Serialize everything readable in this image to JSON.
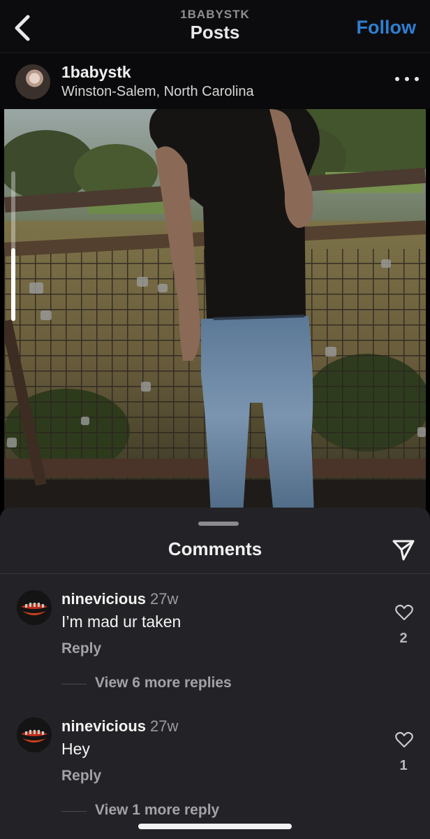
{
  "nav": {
    "subtitle": "1BABYSTK",
    "title": "Posts",
    "follow_label": "Follow"
  },
  "post": {
    "username": "1babystk",
    "location": "Winston-Salem, North Carolina"
  },
  "comments_sheet": {
    "title": "Comments",
    "comments": [
      {
        "username": "ninevicious",
        "time": "27w",
        "text": "I’m mad ur taken",
        "reply_label": "Reply",
        "likes": "2",
        "view_replies": "View 6 more replies"
      },
      {
        "username": "ninevicious",
        "time": "27w",
        "text": "Hey",
        "reply_label": "Reply",
        "likes": "1",
        "view_replies": "View 1 more reply"
      }
    ]
  },
  "icons": {
    "back": "chevron-left-icon",
    "more": "more-horizontal-icon",
    "send": "paper-plane-icon",
    "like": "heart-icon"
  },
  "colors": {
    "accent": "#2f7fd1",
    "sheet_bg": "#232327",
    "nav_bg": "#0c0c0e"
  }
}
